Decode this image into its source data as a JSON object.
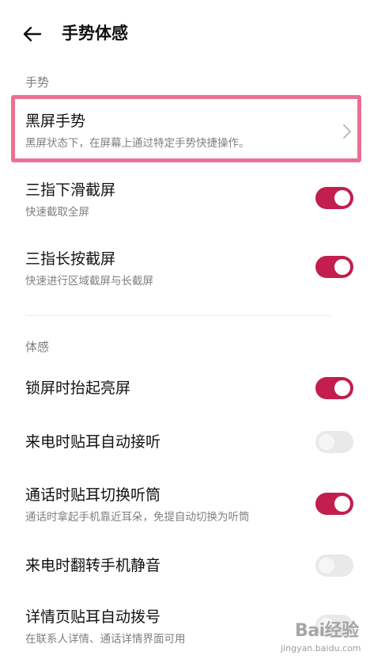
{
  "header": {
    "back_icon": "arrow-left-icon",
    "title": "手势体感"
  },
  "sections": [
    {
      "title": "手势",
      "items": [
        {
          "label": "黑屏手势",
          "sub": "黑屏状态下，在屏幕上通过特定手势快捷操作。",
          "control": "chevron",
          "highlighted": true
        },
        {
          "label": "三指下滑截屏",
          "sub": "快速截取全屏",
          "control": "toggle",
          "on": true
        },
        {
          "label": "三指长按截屏",
          "sub": "快速进行区域截屏与长截屏",
          "control": "toggle",
          "on": true
        }
      ]
    },
    {
      "title": "体感",
      "items": [
        {
          "label": "锁屏时抬起亮屏",
          "sub": "",
          "control": "toggle",
          "on": true
        },
        {
          "label": "来电时贴耳自动接听",
          "sub": "",
          "control": "toggle",
          "on": false
        },
        {
          "label": "通话时贴耳切换听筒",
          "sub": "通话时拿起手机靠近耳朵，免提自动切换为听筒",
          "control": "toggle",
          "on": true
        },
        {
          "label": "来电时翻转手机静音",
          "sub": "",
          "control": "toggle",
          "on": false
        },
        {
          "label": "详情页贴耳自动拨号",
          "sub": "在联系人详情、通话详情界面可用",
          "control": "toggle",
          "on": false
        }
      ]
    }
  ],
  "colors": {
    "toggle_on": "#c21e4e",
    "toggle_off": "#e9e9e9",
    "highlight_border": "#ec6f93"
  },
  "watermark": {
    "logo": "Bai经验",
    "site": "jingyan.baidu.com"
  }
}
